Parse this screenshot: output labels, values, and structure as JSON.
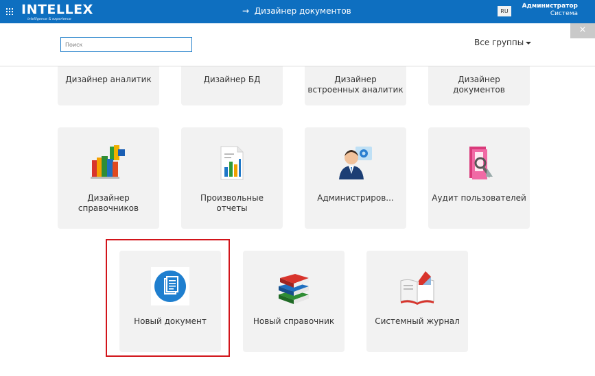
{
  "header": {
    "logo_text": "INTELLEX",
    "logo_tagline": "intelligence & experience",
    "breadcrumb": "Дизайнер документов",
    "breadcrumb_arrow": "→",
    "language": "RU",
    "user_name": "Администратор",
    "user_org": "Система",
    "close_glyph": "×"
  },
  "toolbar": {
    "search_placeholder": "Поиск",
    "groups_label": "Все группы"
  },
  "tiles_row1": [
    {
      "label": "Дизайнер аналитик"
    },
    {
      "label": "Дизайнер БД"
    },
    {
      "label": "Дизайнер встроенных аналитик"
    },
    {
      "label": "Дизайнер документов"
    }
  ],
  "tiles_row2": [
    {
      "label": "Дизайнер справочников",
      "icon": "books-icon"
    },
    {
      "label": "Произвольные отчеты",
      "icon": "report-chart-icon"
    },
    {
      "label": "Администриров...",
      "icon": "admin-user-gear-icon"
    },
    {
      "label": "Аудит пользователей",
      "icon": "audit-folder-icon"
    }
  ],
  "tiles_row3": [
    {
      "label": "Новый документ",
      "icon": "new-document-icon"
    },
    {
      "label": "Новый справочник",
      "icon": "stacked-books-icon"
    },
    {
      "label": "Системный журнал",
      "icon": "open-journal-icon"
    }
  ],
  "colors": {
    "topbar": "#0e6fc0",
    "tile_bg": "#f2f2f2",
    "highlight": "#d2141a"
  }
}
